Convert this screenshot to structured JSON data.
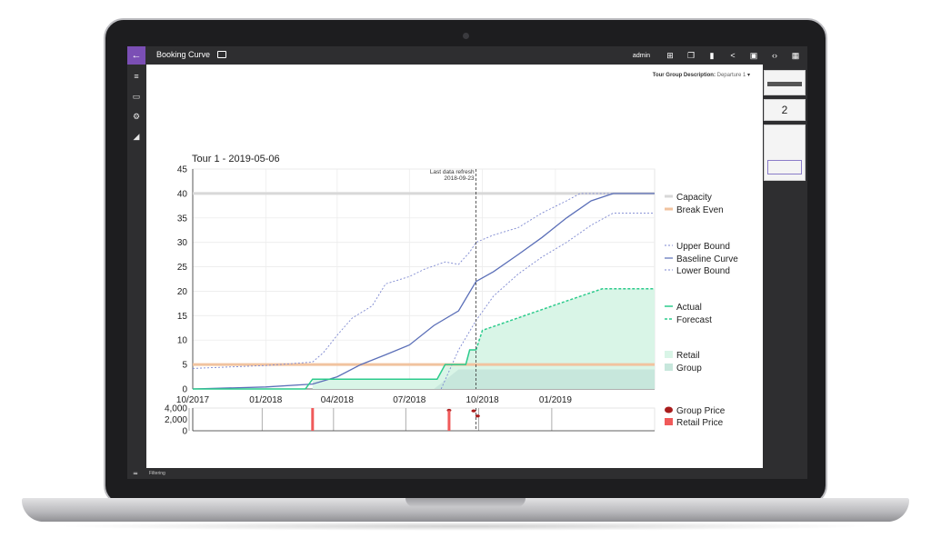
{
  "app": {
    "title": "Booking Curve",
    "user": "admin",
    "footer_text": "Filtering",
    "filter_label": "Tour Group Description:",
    "filter_value": "Departure 1",
    "thumbnail_page": "2"
  },
  "colors": {
    "accent": "#7b4fb5",
    "capacity": "#d8d8d8",
    "break_even": "#f1c39f",
    "baseline": "#5b6fb8",
    "bounds": "#7c87d0",
    "actual": "#2ccb8c",
    "retail_area": "#d9f5e7",
    "group_area": "#c7e7dc",
    "group_price": "#a81c1c",
    "retail_price": "#f05a5a"
  },
  "chart_data": {
    "type": "line",
    "title": "Tour 1 - 2019-05-06",
    "x_axis": {
      "type": "date",
      "range": [
        "2017-10-01",
        "2019-05-06"
      ],
      "ticks": [
        "10/2017",
        "01/2018",
        "04/2018",
        "07/2018",
        "10/2018",
        "01/2019"
      ]
    },
    "y_axis": {
      "range": [
        0,
        45
      ],
      "ticks": [
        0,
        5,
        10,
        15,
        20,
        25,
        30,
        35,
        40,
        45
      ]
    },
    "annotation": {
      "label": "Last data refresh",
      "date": "2018-09-23"
    },
    "capacity": {
      "name": "Capacity",
      "value": 40
    },
    "break_even": {
      "name": "Break Even",
      "value": 5
    },
    "series": [
      {
        "name": "Upper Bound",
        "style": "dashed",
        "points": [
          [
            "2017-10-01",
            4.2
          ],
          [
            "2018-01-01",
            4.8
          ],
          [
            "2018-03-01",
            5.5
          ],
          [
            "2018-03-15",
            7.5
          ],
          [
            "2018-04-01",
            11
          ],
          [
            "2018-04-20",
            14.5
          ],
          [
            "2018-05-15",
            17
          ],
          [
            "2018-06-01",
            21.5
          ],
          [
            "2018-07-01",
            23
          ],
          [
            "2018-07-20",
            24.5
          ],
          [
            "2018-08-15",
            26
          ],
          [
            "2018-09-01",
            25.5
          ],
          [
            "2018-09-15",
            28
          ],
          [
            "2018-09-23",
            30
          ],
          [
            "2018-10-15",
            31.5
          ],
          [
            "2018-11-15",
            33
          ],
          [
            "2018-12-15",
            36
          ],
          [
            "2019-01-15",
            38.5
          ],
          [
            "2019-02-01",
            40
          ],
          [
            "2019-03-01",
            40
          ],
          [
            "2019-05-06",
            40
          ]
        ]
      },
      {
        "name": "Baseline Curve",
        "style": "solid",
        "points": [
          [
            "2017-10-01",
            0
          ],
          [
            "2018-01-01",
            0.4
          ],
          [
            "2018-03-01",
            1
          ],
          [
            "2018-04-01",
            2.5
          ],
          [
            "2018-05-01",
            5
          ],
          [
            "2018-06-01",
            7
          ],
          [
            "2018-07-01",
            9
          ],
          [
            "2018-08-01",
            13
          ],
          [
            "2018-09-01",
            16
          ],
          [
            "2018-09-23",
            22
          ],
          [
            "2018-10-15",
            24
          ],
          [
            "2018-11-15",
            27.5
          ],
          [
            "2018-12-15",
            31
          ],
          [
            "2019-01-15",
            35
          ],
          [
            "2019-02-15",
            38.5
          ],
          [
            "2019-03-15",
            40
          ],
          [
            "2019-05-06",
            40
          ]
        ]
      },
      {
        "name": "Lower Bound",
        "style": "dashed",
        "points": [
          [
            "2018-08-10",
            0
          ],
          [
            "2018-09-01",
            8
          ],
          [
            "2018-09-23",
            14
          ],
          [
            "2018-10-15",
            19
          ],
          [
            "2018-11-15",
            23.5
          ],
          [
            "2018-12-15",
            27
          ],
          [
            "2019-01-15",
            30
          ],
          [
            "2019-02-15",
            33.5
          ],
          [
            "2019-03-15",
            36
          ],
          [
            "2019-05-06",
            36
          ]
        ]
      },
      {
        "name": "Actual",
        "style": "solid",
        "points": [
          [
            "2017-10-01",
            0
          ],
          [
            "2018-02-20",
            0
          ],
          [
            "2018-03-01",
            2
          ],
          [
            "2018-08-05",
            2
          ],
          [
            "2018-08-15",
            5
          ],
          [
            "2018-09-10",
            5
          ],
          [
            "2018-09-15",
            8
          ],
          [
            "2018-09-23",
            8
          ]
        ]
      },
      {
        "name": "Forecast",
        "style": "dashed",
        "points": [
          [
            "2018-09-23",
            8
          ],
          [
            "2018-10-01",
            12
          ],
          [
            "2019-01-15",
            18
          ],
          [
            "2019-03-01",
            20.5
          ],
          [
            "2019-05-06",
            20.5
          ]
        ]
      }
    ],
    "areas": [
      {
        "name": "Retail",
        "points": [
          [
            "2018-03-01",
            2
          ],
          [
            "2018-08-05",
            2
          ],
          [
            "2018-08-15",
            5
          ],
          [
            "2018-09-10",
            5
          ],
          [
            "2018-09-15",
            8
          ],
          [
            "2018-09-23",
            8
          ],
          [
            "2018-10-01",
            12
          ],
          [
            "2019-01-15",
            18
          ],
          [
            "2019-03-01",
            20.5
          ],
          [
            "2019-05-06",
            20.5
          ]
        ]
      },
      {
        "name": "Group",
        "points": [
          [
            "2018-08-01",
            0
          ],
          [
            "2018-09-01",
            4
          ],
          [
            "2018-10-01",
            4
          ],
          [
            "2019-05-06",
            4
          ]
        ]
      }
    ],
    "price_chart": {
      "y_ticks": [
        "4,000",
        "2,000",
        "0"
      ],
      "y_range": [
        0,
        4000
      ],
      "series": [
        {
          "name": "Group Price",
          "type": "scatter",
          "points": [
            [
              "2018-08-20",
              3600
            ],
            [
              "2018-09-20",
              3500
            ],
            [
              "2018-09-25",
              2600
            ]
          ]
        },
        {
          "name": "Retail Price",
          "type": "bar",
          "points": [
            [
              "2018-03-01",
              4000
            ],
            [
              "2018-08-20",
              3600
            ]
          ]
        }
      ]
    },
    "legend": {
      "placement": "right",
      "groups": [
        [
          "Capacity",
          "Break Even"
        ],
        [
          "Upper Bound",
          "Baseline Curve",
          "Lower Bound"
        ],
        [
          "Actual",
          "Forecast"
        ],
        [
          "Retail",
          "Group"
        ],
        [
          "Group Price",
          "Retail Price"
        ]
      ]
    }
  }
}
